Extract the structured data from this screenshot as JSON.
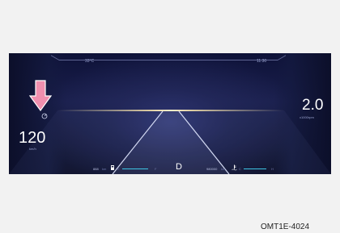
{
  "cluster": {
    "outside_temp": "33°C",
    "clock": "11:30",
    "speed": "120",
    "speed_unit": "km/h",
    "rpm": "2.0",
    "rpm_unit": "x1000rpm",
    "range": "888",
    "range_unit": "km",
    "fuel_empty_label": "E",
    "fuel_full_label": "F",
    "gear": "D",
    "odometer": "980000",
    "odometer_unit": "km",
    "coolant_cold_label": "C",
    "coolant_hot_label": "H"
  },
  "icons": {
    "arrow": "down-arrow-icon",
    "cruise": "cruise-control-icon",
    "fuel": "fuel-pump-icon",
    "coolant": "coolant-temp-icon"
  },
  "colors": {
    "arrow_fill": "#f08fae",
    "gauge_bar": "#3ec6e6",
    "background": "#151a3e"
  },
  "caption": "OMT1E-4024"
}
